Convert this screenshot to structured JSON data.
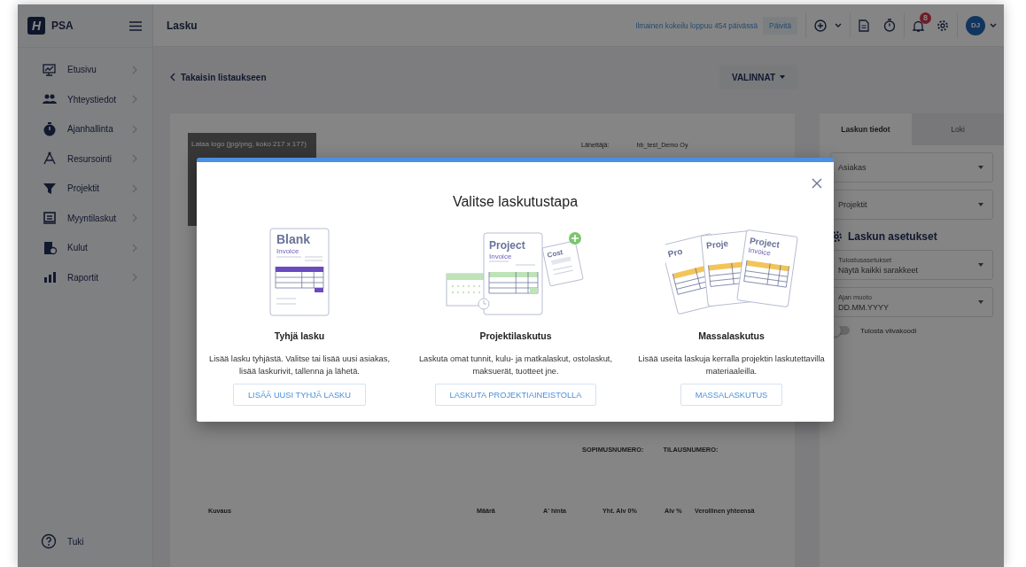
{
  "app": {
    "logo_mark": "H",
    "name": "PSA"
  },
  "sidebar": {
    "items": [
      {
        "label": "Etusivu"
      },
      {
        "label": "Yhteystiedot"
      },
      {
        "label": "Ajanhallinta"
      },
      {
        "label": "Resursointi"
      },
      {
        "label": "Projektit"
      },
      {
        "label": "Myyntilaskut"
      },
      {
        "label": "Kulut"
      },
      {
        "label": "Raportit"
      }
    ],
    "help": "Tuki"
  },
  "header": {
    "title": "Lasku",
    "trial_notice": "Ilmainen kokeilu loppuu 454 päivässä",
    "upgrade_button": "Päivitä",
    "notification_count": "8",
    "avatar_initials": "DJ"
  },
  "page": {
    "back_link": "Takaisin listaukseen",
    "options_button": "VALINNAT"
  },
  "invoice": {
    "logo_upload": "Lataa logo (jpg/png, koko 217 x 177)",
    "sender_label": "Lähettäjä:",
    "sender_value": "hb_test_Demo Oy",
    "reference_fields": [
      "SOPIMUSNUMERO:",
      "TILAUSNUMERO:"
    ],
    "columns": [
      "Kuvaus",
      "Määrä",
      "A' hinta",
      "Yht. Alv 0%",
      "Alv %",
      "Verollinen yhteensä"
    ]
  },
  "panel": {
    "tabs": [
      {
        "label": "Laskun tiedot",
        "selected": true
      },
      {
        "label": "Loki",
        "selected": false
      }
    ],
    "selects": [
      {
        "placeholder": "Asiakas"
      },
      {
        "placeholder": "Projektit"
      }
    ],
    "settings_title": "Laskun asetukset",
    "settings": [
      {
        "label": "Tulostusasetukset",
        "value": "Näytä kaikki sarakkeet"
      },
      {
        "label": "Ajan muoto",
        "value": "DD.MM.YYYY"
      }
    ],
    "toggle": {
      "label": "Tulosta viivakoodi",
      "on": false
    }
  },
  "modal": {
    "title": "Valitse laskutustapa",
    "options": [
      {
        "kind": "blank",
        "art_texts": [
          "Blank",
          "Invoice"
        ],
        "title": "Tyhjä lasku",
        "description": "Lisää lasku tyhjästä. Valitse tai lisää uusi asiakas, lisää laskurivit, tallenna ja lähetä.",
        "button": "LISÄÄ UUSI TYHJÄ LASKU"
      },
      {
        "kind": "project",
        "art_texts": [
          "Project",
          "Invoice",
          "Cost"
        ],
        "title": "Projektilaskutus",
        "description": "Laskuta omat tunnit, kulu- ja matkalaskut, ostolaskut, maksuerät, tuotteet jne.",
        "button": "LASKUTA PROJEKTIAINEISTOLLA"
      },
      {
        "kind": "mass",
        "art_texts": [
          "Pro",
          "Proje",
          "Project",
          "Invoice"
        ],
        "title": "Massalaskutus",
        "description": "Lisää useita laskuja kerralla projektin laskutettavilla materiaaleilla.",
        "button": "MASSALASKUTUS"
      }
    ]
  }
}
